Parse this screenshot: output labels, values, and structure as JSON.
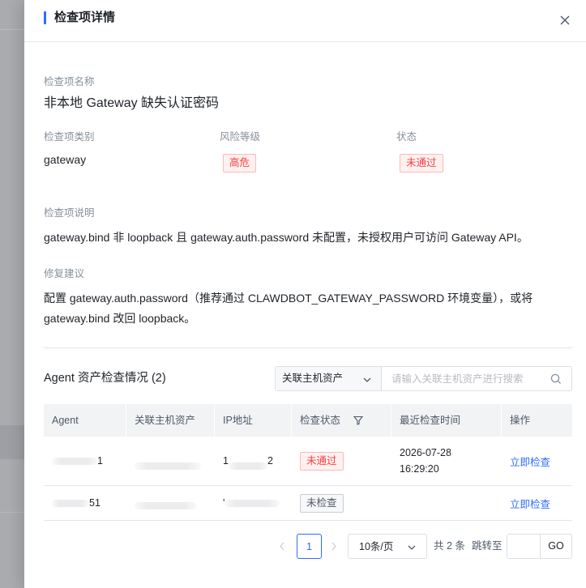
{
  "drawer": {
    "title": "检查项详情"
  },
  "detail": {
    "name_label": "检查项名称",
    "name_value": "非本地 Gateway 缺失认证密码",
    "category_label": "检查项类别",
    "category_value": "gateway",
    "risk_label": "风险等级",
    "risk_value": "高危",
    "status_label": "状态",
    "status_value": "未通过",
    "description_label": "检查项说明",
    "description_value": "gateway.bind 非 loopback 且 gateway.auth.password 未配置，未授权用户可访问 Gateway API。",
    "fix_label": "修复建议",
    "fix_value_line1": "配置 gateway.auth.password（推荐通过 CLAWDBOT_GATEWAY_PASSWORD 环境变量），或将",
    "fix_value_line2": "gateway.bind 改回 loopback。"
  },
  "assets": {
    "title": "Agent 资产检查情况 (2)",
    "filter_select": "关联主机资产",
    "search_placeholder": "请输入关联主机资产进行搜索",
    "columns": [
      "Agent",
      "关联主机资产",
      "IP地址",
      "检查状态",
      "最近检查时间",
      "操作"
    ],
    "rows": [
      {
        "agent": "1",
        "host": "",
        "ip_start": "1",
        "ip_end": "2",
        "status": "未通过",
        "time_date": "2026-07-28",
        "time_clock": "16:29:20",
        "action": "立即检查"
      },
      {
        "agent": "51",
        "host": "",
        "ip_start": "'",
        "ip_end": "",
        "status": "未检查",
        "time_date": "",
        "time_clock": "",
        "action": "立即检查"
      }
    ]
  },
  "pagination": {
    "current_page": "1",
    "page_size": "10条/页",
    "total": "共 2 条",
    "jump_label": "跳转至",
    "go_label": "GO"
  },
  "colors": {
    "accent": "#2f6bff",
    "danger": "#f53f3f"
  }
}
